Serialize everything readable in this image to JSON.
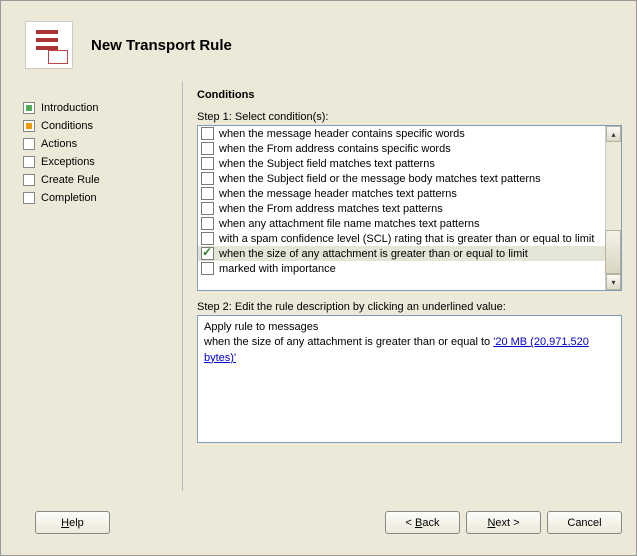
{
  "header": {
    "title": "New Transport Rule"
  },
  "nav": {
    "items": [
      {
        "label": "Introduction",
        "state": "green"
      },
      {
        "label": "Conditions",
        "state": "orange"
      },
      {
        "label": "Actions",
        "state": ""
      },
      {
        "label": "Exceptions",
        "state": ""
      },
      {
        "label": "Create Rule",
        "state": ""
      },
      {
        "label": "Completion",
        "state": ""
      }
    ]
  },
  "main": {
    "heading": "Conditions",
    "step1_label": "Step 1: Select condition(s):",
    "conditions": [
      {
        "label": "when the message header contains specific words",
        "checked": false,
        "selected": false
      },
      {
        "label": "when the From address contains specific words",
        "checked": false,
        "selected": false
      },
      {
        "label": "when the Subject field matches text patterns",
        "checked": false,
        "selected": false
      },
      {
        "label": "when the Subject field or the message body matches text patterns",
        "checked": false,
        "selected": false
      },
      {
        "label": "when the message header matches text patterns",
        "checked": false,
        "selected": false
      },
      {
        "label": "when the From address matches text patterns",
        "checked": false,
        "selected": false
      },
      {
        "label": "when any attachment file name matches text patterns",
        "checked": false,
        "selected": false
      },
      {
        "label": "with a spam confidence level (SCL) rating that is greater than or equal to limit",
        "checked": false,
        "selected": false
      },
      {
        "label": "when the size of any attachment is greater than or equal to limit",
        "checked": true,
        "selected": true
      },
      {
        "label": "marked with importance",
        "checked": false,
        "selected": false
      }
    ],
    "step2_label": "Step 2: Edit the rule description by clicking an underlined value:",
    "description": {
      "line1": "Apply rule to messages",
      "line2_prefix": "when the size of any attachment is greater than or equal to ",
      "line2_link": "'20 MB (20,971,520 bytes)'"
    }
  },
  "footer": {
    "help": "Help",
    "back": "Back",
    "next": "Next",
    "cancel": "Cancel"
  }
}
